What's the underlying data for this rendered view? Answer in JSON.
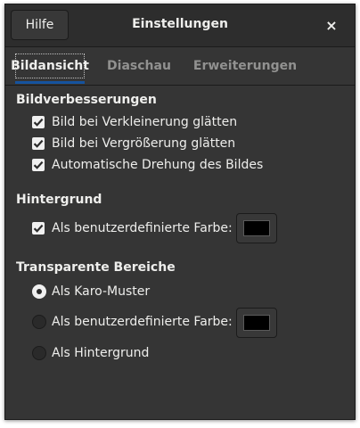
{
  "header": {
    "help_label": "Hilfe",
    "title": "Einstellungen",
    "close_icon": "×"
  },
  "tabs": [
    {
      "label": "Bildansicht",
      "active": true
    },
    {
      "label": "Diaschau",
      "active": false
    },
    {
      "label": "Erweiterungen",
      "active": false
    }
  ],
  "enhancements": {
    "heading": "Bildverbesserungen",
    "options": [
      {
        "label": "Bild bei Verkleinerung glätten",
        "checked": true
      },
      {
        "label": "Bild bei Vergrößerung glätten",
        "checked": true
      },
      {
        "label": "Automatische Drehung des Bildes",
        "checked": true
      }
    ]
  },
  "background": {
    "heading": "Hintergrund",
    "custom_color_label": "Als benutzerdefinierte Farbe:",
    "custom_color_checked": true,
    "color": "#000000"
  },
  "transparency": {
    "heading": "Transparente Bereiche",
    "options": [
      {
        "label": "Als Karo-Muster",
        "selected": true
      },
      {
        "label": "Als benutzerdefinierte Farbe:",
        "selected": false
      },
      {
        "label": "Als Hintergrund",
        "selected": false
      }
    ],
    "color": "#000000"
  },
  "colors": {
    "window_bg": "#353535",
    "header_bg": "#2d2d2d",
    "accent": "#15539e",
    "text": "#eeeeec",
    "inactive_tab": "#919190"
  }
}
